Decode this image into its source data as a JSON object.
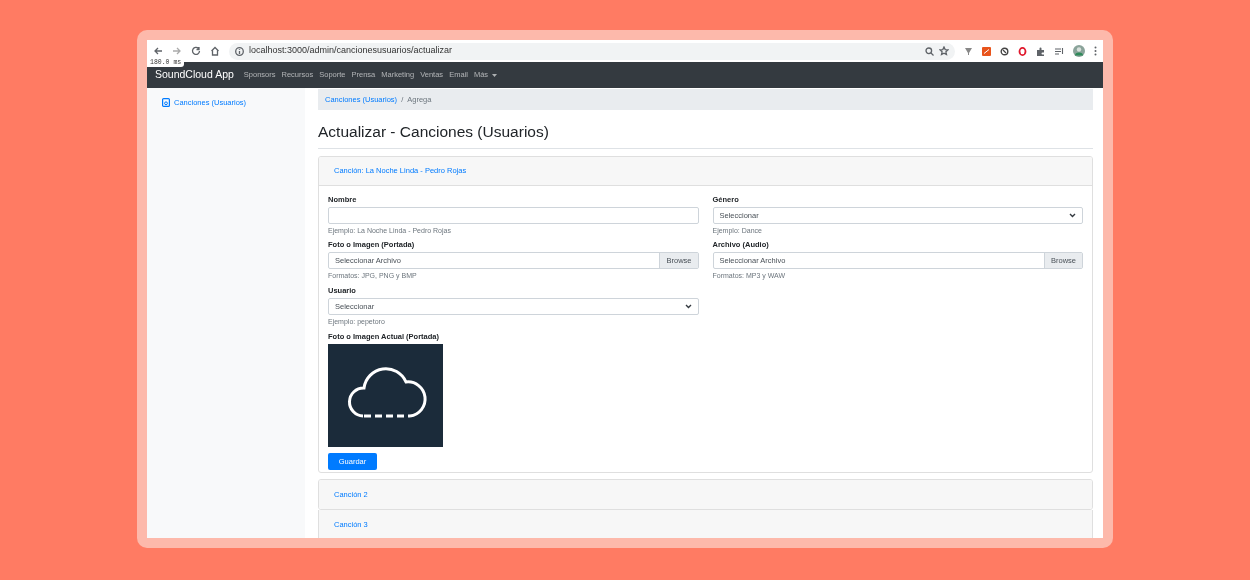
{
  "browser": {
    "url": "localhost:3000/admin/cancionesusuarios/actualizar",
    "timing": "180.0 ms"
  },
  "navbar": {
    "brand": "SoundCloud App",
    "links": [
      "Sponsors",
      "Recursos",
      "Soporte",
      "Prensa",
      "Marketing",
      "Ventas",
      "Email"
    ],
    "dropdown": "Más"
  },
  "sidebar": {
    "items": [
      {
        "label": "Canciones (Usuarios)"
      }
    ]
  },
  "breadcrumb": {
    "separator": "/",
    "items": [
      {
        "label": "Canciones (Usuarios)",
        "active": false
      },
      {
        "label": "Agrega",
        "active": true
      }
    ]
  },
  "page_title": "Actualizar - Canciones (Usuarios)",
  "accordion": [
    {
      "title": "Canción: La Noche Linda - Pedro Rojas",
      "expanded": true,
      "form": {
        "fields": [
          {
            "kind": "text",
            "label": "Nombre",
            "help": "Ejemplo: La Noche Linda - Pedro Rojas"
          },
          {
            "kind": "select",
            "label": "Género",
            "value": "Seleccionar",
            "help": "Ejemplo: Dance"
          },
          {
            "kind": "file",
            "label": "Foto o Imagen (Portada)",
            "placeholder": "Seleccionar Archivo",
            "button": "Browse",
            "help": "Formatos: JPG, PNG y BMP"
          },
          {
            "kind": "file",
            "label": "Archivo (Audio)",
            "placeholder": "Seleccionar Archivo",
            "button": "Browse",
            "help": "Formatos: MP3 y WAW"
          },
          {
            "kind": "select",
            "label": "Usuario",
            "value": "Seleccionar",
            "help": "Ejemplo: pepetoro"
          }
        ],
        "current_image": {
          "label": "Foto o Imagen Actual (Portada)"
        },
        "submit": "Guardar"
      }
    },
    {
      "title": "Canción 2",
      "expanded": false
    },
    {
      "title": "Canción 3",
      "expanded": false
    }
  ]
}
